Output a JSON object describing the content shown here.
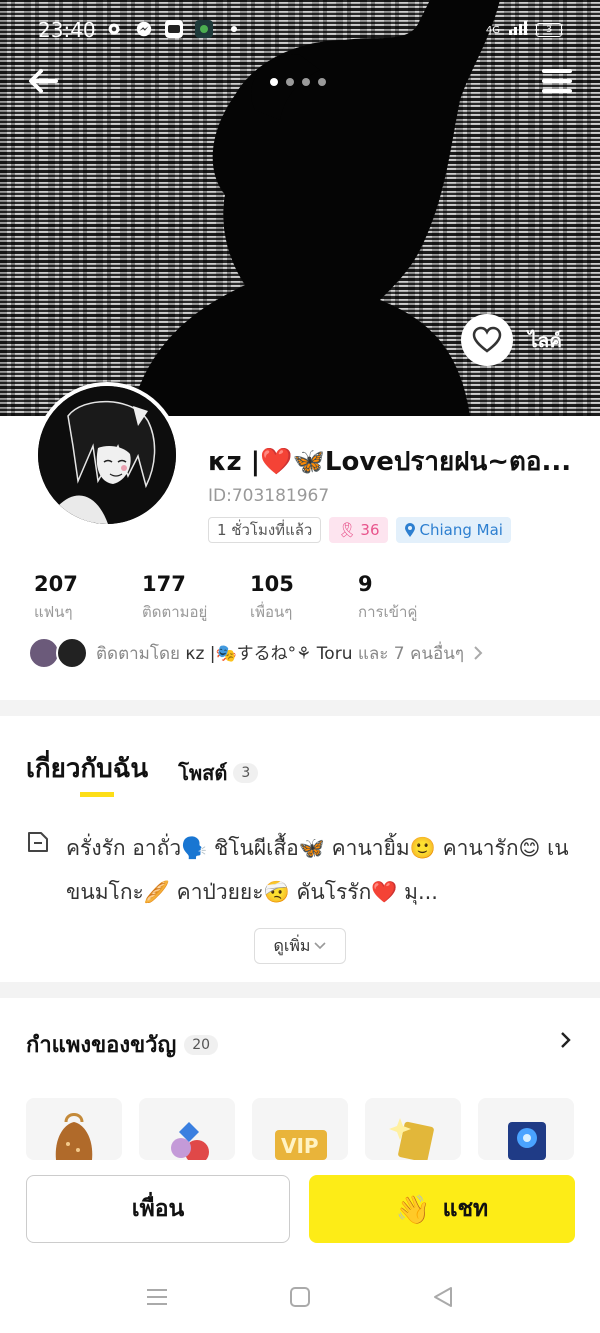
{
  "status": {
    "time": "23:40",
    "network": "4G",
    "battery": "3"
  },
  "hero": {
    "like_label": "ไลค์"
  },
  "profile": {
    "name": "κz |❤️🦋Loveปรายฝน~ตอ...",
    "id": "ID:703181967",
    "last_seen": "1 ชั่วโมงที่แล้ว",
    "level": "36",
    "location": "Chiang Mai"
  },
  "stats": [
    {
      "value": "207",
      "label": "แฟนๆ"
    },
    {
      "value": "177",
      "label": "ติดตามอยู่"
    },
    {
      "value": "105",
      "label": "เพื่อนๆ"
    },
    {
      "value": "9",
      "label": "การเข้าคู่"
    }
  ],
  "followed_by": {
    "prefix": "ติดตามโดย",
    "names": "κz |🎭するね°⚘ Toru",
    "suffix": "และ 7 คนอื่นๆ"
  },
  "tabs": {
    "about": "เกี่ยวกับฉัน",
    "posts": "โพสต์",
    "posts_count": "3"
  },
  "bio": {
    "text": "ครั่งรัก อาถั่ว🗣️ ชิโนผีเสื้อ🦋 คานายิ้ม🙂 คานารัก😊 เนขนมโกะ🥖 คาป่วยยะ🤕 คันโรรัก❤️ มุ...",
    "more_label": "ดูเพิ่ม"
  },
  "gifts": {
    "title": "กำแพงของขวัญ",
    "count": "20",
    "items": [
      "bag-gift",
      "gem-gift",
      "vip-gift",
      "card-gift",
      "frame-gift"
    ]
  },
  "actions": {
    "friend_label": "เพื่อน",
    "chat_label": "แชท"
  },
  "colors": {
    "accent": "#fdec17",
    "level_pink": "#e8558c",
    "location_blue": "#2d7fd0"
  }
}
